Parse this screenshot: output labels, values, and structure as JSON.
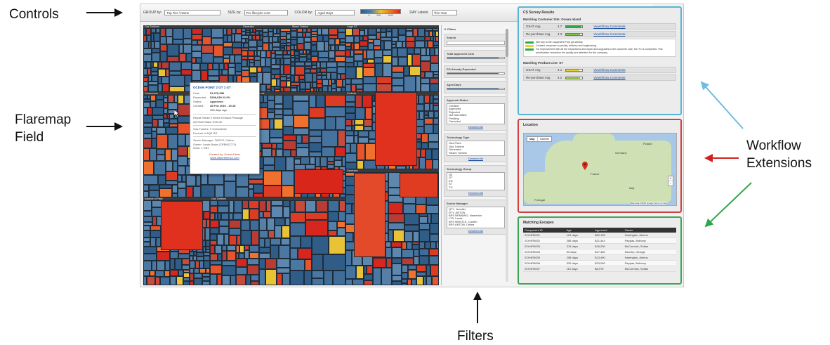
{
  "callouts": {
    "controls": "Controls",
    "flaremap": [
      "Flaremap",
      "Field"
    ],
    "filters": "Filters",
    "workflow": [
      "Workflow",
      "Extensions"
    ]
  },
  "controls": {
    "items": [
      {
        "label": "GROUP by:",
        "value": "Top Tier / Name"
      },
      {
        "label": "SIZE by:",
        "value": "Per lifecycle cost"
      },
      {
        "label": "COLOR by:",
        "value": "Aged Days"
      },
      {
        "label": "DAY Labels:",
        "value": "This Year"
      }
    ],
    "legend_ticks": [
      "0",
      "500",
      "1000"
    ],
    "colors": {
      "low": "#2f5d87",
      "mid": "#e9c235",
      "high": "#d7261d"
    }
  },
  "treemap": {
    "groups": [
      "Gas Turbines",
      "Generator",
      "Steam Turbine",
      "Large GT",
      "Compressor",
      "Aux Systems",
      "Controls",
      "Balance of Plant"
    ]
  },
  "tooltip": {
    "title": "OCEAN POINT 2 GT 1 GT",
    "rows": [
      {
        "k": "Cost:",
        "v": "$1,378,988"
      },
      {
        "k": "Expended:",
        "v": "$298,638  22.0%"
      },
      {
        "k": "Status:",
        "v": "Approved"
      },
      {
        "k": "Created:",
        "v": "28 Feb 2016 - 19:15"
      },
      {
        "k": "",
        "v": "996 days ago"
      }
    ],
    "desc": [
      "Repair Steam Turbine Exhaust Passage",
      "Aft Shell Stator Retrofit"
    ],
    "meta": [
      "Gas Turbine: 9 Oxfordshire",
      "Product: #  AQ5 GG"
    ],
    "owner": [
      "Senior Manager: TASCO, Celina",
      "Owner: Lewis Boyle (CRBMCC73)",
      "Work: 1 RBY"
    ],
    "created_by": "Created by: Guest Admin",
    "link": "www.sitereference.com"
  },
  "filters": {
    "header": "Filters",
    "sections": [
      {
        "label": "Search",
        "kind": "input"
      },
      {
        "label": "Total Approved Cost",
        "kind": "slider"
      },
      {
        "label": "PO Already Expended",
        "kind": "slider"
      },
      {
        "label": "Aged Days",
        "kind": "slider"
      },
      {
        "label": "Approval Status",
        "kind": "list",
        "items": [
          "Created",
          "Approved",
          "Rejected",
          "Not Submitted",
          "Pending",
          "Canceled"
        ]
      },
      {
        "label": "Technology Type",
        "kind": "list",
        "items": [
          "Gas Fired",
          "Gas Turbine",
          "Generator",
          "Steam Turbine"
        ]
      },
      {
        "label": "Technology Group",
        "kind": "list",
        "items": [
          "Oil",
          "GT",
          "EG",
          "ST",
          "TG"
        ]
      },
      {
        "label": "Senior Manager",
        "kind": "list",
        "items": [
          "QTY, Jennifer",
          "RTY, ANTON",
          "BPS HENNING, Hamerton",
          "LTS, Lewis",
          "BPS MENTLE, Cumbri",
          "BPS ANTON, Celine"
        ]
      }
    ],
    "select_all": "Deselect All"
  },
  "survey": {
    "title": "CS Survey Results",
    "sub1": "Matching Customer Site: Ocean Island",
    "rows1": [
      {
        "label": "OSAT Avg",
        "val": "4.7",
        "fill": 0.94,
        "color": "#2fa84a",
        "link": "View/Show Comments"
      },
      {
        "label": "Re-purchase Avg",
        "val": "4.3",
        "fill": 0.86,
        "color": "#7cc44a",
        "link": "View/Show Comments"
      }
    ],
    "notes": [
      "Site key to the equipment Post QA weekly.",
      "Created, response to priority, delivery and engineering.",
      "For improvement with all the inspections and repair and upgrades to the customer care, the TC is completed. This prioritization resolution the quality and attention for the company."
    ],
    "sub2": "Matching Product Line: ST",
    "rows2": [
      {
        "label": "OSAT Avg",
        "val": "4.1",
        "fill": 0.82,
        "color": "#e3d334",
        "link": "View/Show Comments"
      },
      {
        "label": "Re-purchase Avg",
        "val": "4.2",
        "fill": 0.84,
        "color": "#9fcf45",
        "link": "View/Show Comments"
      }
    ]
  },
  "location": {
    "title": "Location",
    "map_type": [
      "Map",
      "Satellite"
    ],
    "labels": [
      "Poland",
      "Germany",
      "France",
      "Portugal",
      "Italy"
    ],
    "zoom": [
      "+",
      "−"
    ],
    "attribution": "Map data ©2016 Google  Terms of Use"
  },
  "escapes": {
    "title": "Matching Escapes",
    "columns": [
      "Component ID",
      "Age",
      "Approved",
      "Owner"
    ],
    "rows": [
      [
        "2CH4R3001",
        "101 days",
        "$52,155",
        "Harrington, Alenno"
      ],
      [
        "2CH4R3002",
        "285 days",
        "$21,444",
        "Pappas, Anthony"
      ],
      [
        "2CH4R3003",
        "215 days",
        "$16,200",
        "McCormick, Sofian"
      ],
      [
        "2CH4R3004",
        "50 days",
        "$17,482",
        "Sancho, George"
      ],
      [
        "2CH4R3005",
        "208 days",
        "$13,490",
        "Harrington, Alenno"
      ],
      [
        "2CH4R3006",
        "330 days",
        "$23,000",
        "Pappas, Anthony"
      ],
      [
        "2CH4R3007",
        "110 days",
        "$8,975",
        "McCormick, Sofian"
      ]
    ]
  }
}
